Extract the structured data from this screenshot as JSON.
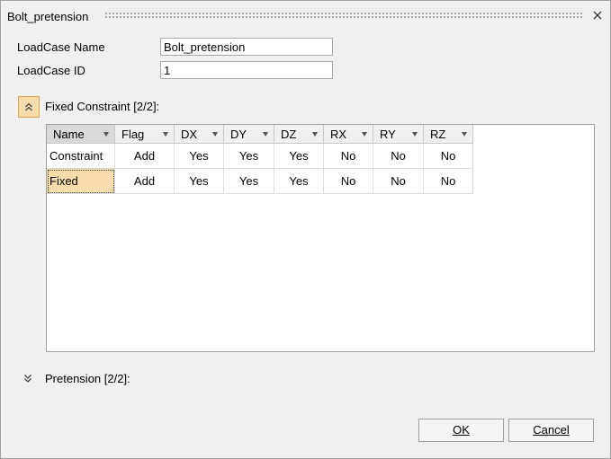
{
  "window": {
    "title": "Bolt_pretension",
    "close_icon": "close-icon"
  },
  "form": {
    "loadcase_name_label": "LoadCase Name",
    "loadcase_name_value": "Bolt_pretension",
    "loadcase_id_label": "LoadCase ID",
    "loadcase_id_value": "1"
  },
  "fixed_section": {
    "label": "Fixed Constraint [2/2]:",
    "expanded": true,
    "columns": [
      "Name",
      "Flag",
      "DX",
      "DY",
      "DZ",
      "RX",
      "RY",
      "RZ"
    ],
    "rows": [
      [
        "Constraint",
        "Add",
        "Yes",
        "Yes",
        "Yes",
        "No",
        "No",
        "No"
      ],
      [
        "Fixed",
        "Add",
        "Yes",
        "Yes",
        "Yes",
        "No",
        "No",
        "No"
      ]
    ],
    "selected_cell": "Fixed"
  },
  "pretension_section": {
    "label": "Pretension [2/2]:",
    "expanded": false
  },
  "buttons": {
    "ok": "OK",
    "cancel": "Cancel"
  },
  "colors": {
    "highlight": "#f6dcaa",
    "highlight_border": "#d9a857",
    "background": "#f0f0f0"
  }
}
